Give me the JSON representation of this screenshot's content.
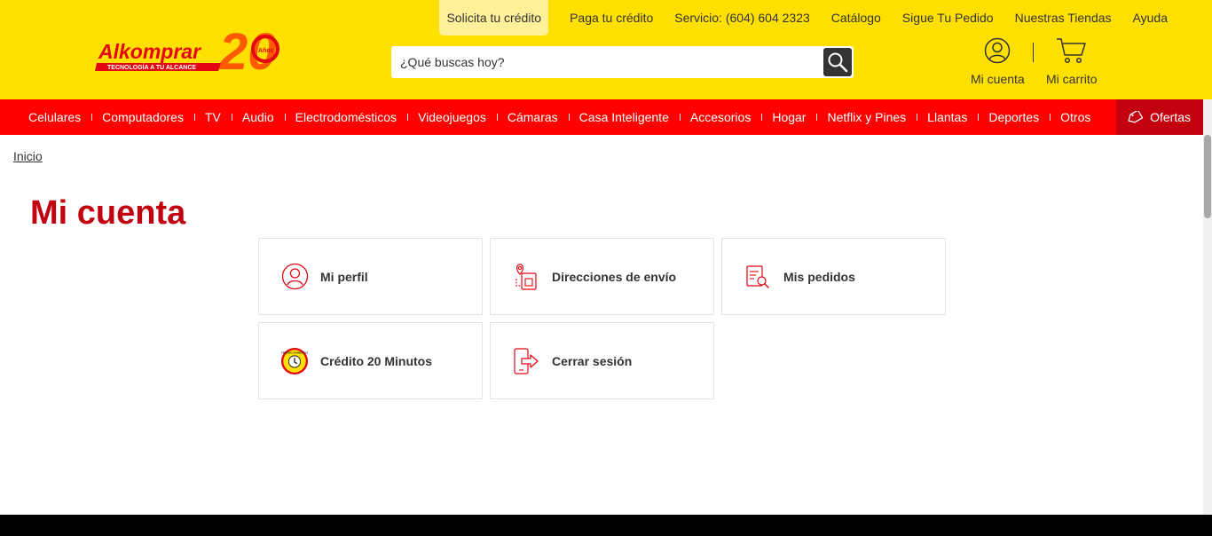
{
  "header": {
    "logo": {
      "brand": "Alkomprar",
      "tagline": "TECNOLOGÍA A TU ALCANCE",
      "anniversary": "20",
      "anniversary_word": "Años"
    },
    "top_links": [
      {
        "label": "Solicita tu crédito"
      },
      {
        "label": "Paga tu crédito"
      },
      {
        "label": "Servicio: (604) 604 2323"
      },
      {
        "label": "Catálogo"
      },
      {
        "label": "Sigue Tu Pedido"
      },
      {
        "label": "Nuestras Tiendas"
      },
      {
        "label": "Ayuda"
      }
    ],
    "search": {
      "placeholder": "¿Qué buscas hoy?",
      "value": ""
    },
    "account_label": "Mi cuenta",
    "cart_label": "Mi carrito"
  },
  "nav": {
    "items": [
      {
        "label": "Celulares"
      },
      {
        "label": "Computadores"
      },
      {
        "label": "TV"
      },
      {
        "label": "Audio"
      },
      {
        "label": "Electrodomésticos"
      },
      {
        "label": "Videojuegos"
      },
      {
        "label": "Cámaras"
      },
      {
        "label": "Casa Inteligente"
      },
      {
        "label": "Accesorios"
      },
      {
        "label": "Hogar"
      },
      {
        "label": "Netflix y Pines"
      },
      {
        "label": "Llantas"
      },
      {
        "label": "Deportes"
      },
      {
        "label": "Otros"
      }
    ],
    "offers_label": "Ofertas"
  },
  "breadcrumb": {
    "home": "Inicio"
  },
  "page": {
    "title": "Mi cuenta",
    "cards": [
      {
        "label": "Mi perfil",
        "icon": "user-icon"
      },
      {
        "label": "Direcciones de envío",
        "icon": "address-pin-icon"
      },
      {
        "label": "Mis pedidos",
        "icon": "orders-search-icon"
      },
      {
        "label": "Crédito 20 Minutos",
        "icon": "credit-20-minutes-icon",
        "badge_text": "CRÉDITO 20 MINUTOS"
      },
      {
        "label": "Cerrar sesión",
        "icon": "logout-icon"
      }
    ]
  },
  "colors": {
    "header_bg": "#FFE000",
    "nav_bg": "#FF0000",
    "offers_bg": "#C3000F",
    "title_red": "#C3000F",
    "icon_red": "#E30613"
  }
}
